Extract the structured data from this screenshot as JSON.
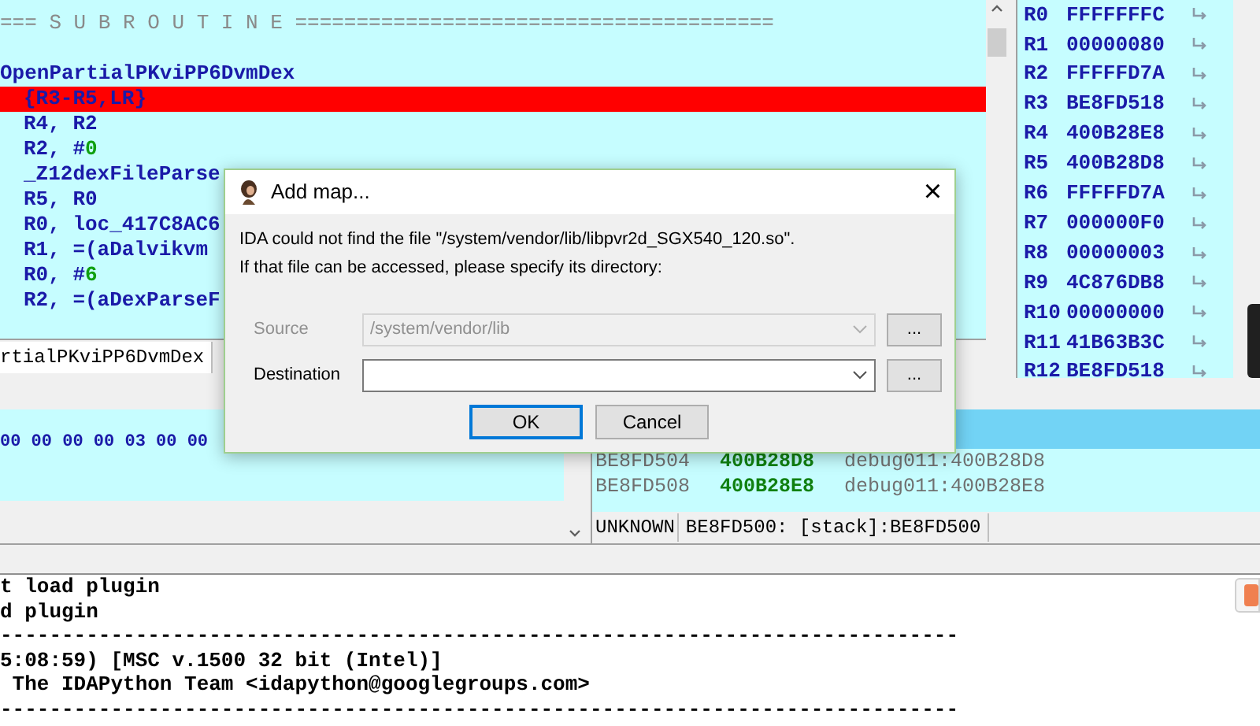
{
  "disassembly": {
    "lines": [
      {
        "kind": "separator",
        "text": "=== S U B R O U T I N E =======================================",
        "current": false
      },
      {
        "kind": "blank",
        "current": false
      },
      {
        "kind": "label",
        "text": "OpenPartialPKviPP6DvmDex",
        "current": false
      },
      {
        "kind": "code",
        "text": "{R3-R5,LR}",
        "current": true
      },
      {
        "kind": "code",
        "text": "R4, R2",
        "current": false
      },
      {
        "kind": "code",
        "text": "R2, #",
        "immediate": "0",
        "current": false
      },
      {
        "kind": "code",
        "text": "_Z12dexFileParse",
        "current": false
      },
      {
        "kind": "code",
        "text": "R5, R0",
        "current": false
      },
      {
        "kind": "code",
        "text": "R0, loc_417C8AC6",
        "current": false
      },
      {
        "kind": "code",
        "text": "R1, =(aDalvikvm",
        "current": false
      },
      {
        "kind": "code",
        "text": "R0, #",
        "immediate": "6",
        "current": false
      },
      {
        "kind": "code",
        "text": "R2, =(aDexParseF",
        "current": false
      }
    ],
    "status": "rtialPKviPP6DvmDex"
  },
  "registers": [
    {
      "name": "R0",
      "value": "FFFFFFFC"
    },
    {
      "name": "R1",
      "value": "00000080"
    },
    {
      "name": "R2",
      "value": "FFFFFD7A"
    },
    {
      "name": "R3",
      "value": "BE8FD518"
    },
    {
      "name": "R4",
      "value": "400B28E8"
    },
    {
      "name": "R5",
      "value": "400B28D8"
    },
    {
      "name": "R6",
      "value": "FFFFFD7A"
    },
    {
      "name": "R7",
      "value": "000000F0"
    },
    {
      "name": "R8",
      "value": "00000003"
    },
    {
      "name": "R9",
      "value": "4C876DB8"
    },
    {
      "name": "R10",
      "value": "00000000"
    },
    {
      "name": "R11",
      "value": "41B63B3C"
    },
    {
      "name": "R12",
      "value": "BE8FD518"
    }
  ],
  "hex_view": {
    "line": "00 00 00 00 03 00 00"
  },
  "stack_view": {
    "rows": [
      {
        "address": "BE8FD504",
        "value": "400B28D8",
        "comment": "debug011:400B28D8"
      },
      {
        "address": "BE8FD508",
        "value": "400B28E8",
        "comment": "debug011:400B28E8"
      }
    ],
    "status_kind": "UNKNOWN",
    "status": "BE8FD500: [stack]:BE8FD500"
  },
  "output": {
    "lines": [
      "t load plugin",
      "d plugin",
      "------------------------------------------------------------------------------",
      "5:08:59) [MSC v.1500 32 bit (Intel)]",
      " The IDAPython Team <idapython@googlegroups.com>",
      "------------------------------------------------------------------------------"
    ]
  },
  "dialog": {
    "title": "Add map...",
    "close": "×",
    "message": [
      "IDA could not find the file \"/system/vendor/lib/libpvr2d_SGX540_120.so\".",
      "If that file can be accessed, please specify its directory:"
    ],
    "fields": [
      {
        "label": "Source",
        "value": "/system/vendor/lib",
        "disabled": true,
        "browse": "..."
      },
      {
        "label": "Destination",
        "disabled": false,
        "browse": "..."
      }
    ],
    "buttons": [
      {
        "label": "OK",
        "default": true
      },
      {
        "label": "Cancel",
        "default": false
      }
    ]
  }
}
